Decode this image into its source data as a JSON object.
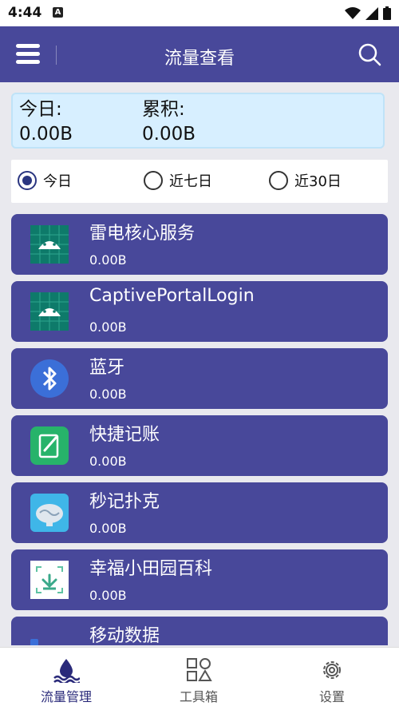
{
  "status": {
    "time": "4:44"
  },
  "appbar": {
    "title": "流量查看"
  },
  "summary": {
    "today_label": "今日:",
    "today_value": "0.00B",
    "total_label": "累积:",
    "total_value": "0.00B"
  },
  "range": {
    "options": [
      "今日",
      "近七日",
      "近30日"
    ],
    "selected": "今日"
  },
  "apps": [
    {
      "name": "雷电核心服务",
      "usage": "0.00B",
      "icon": "android-icon"
    },
    {
      "name": "CaptivePortalLogin",
      "usage": "0.00B",
      "icon": "android-icon"
    },
    {
      "name": "蓝牙",
      "usage": "0.00B",
      "icon": "bluetooth-icon"
    },
    {
      "name": "快捷记账",
      "usage": "0.00B",
      "icon": "notebook-icon"
    },
    {
      "name": "秒记扑克",
      "usage": "0.00B",
      "icon": "brain-icon"
    },
    {
      "name": "幸福小田园百科",
      "usage": "0.00B",
      "icon": "garden-icon"
    },
    {
      "name": "移动数据",
      "usage": "",
      "icon": "mobile-data-icon"
    }
  ],
  "nav": {
    "items": [
      {
        "label": "流量管理",
        "icon": "water-drop-icon",
        "active": true
      },
      {
        "label": "工具箱",
        "icon": "shapes-icon",
        "active": false
      },
      {
        "label": "设置",
        "icon": "gear-icon",
        "active": false
      }
    ]
  },
  "colors": {
    "primary": "#48489a",
    "summary_bg": "#d7efff",
    "page_bg": "#e9e9ee"
  }
}
